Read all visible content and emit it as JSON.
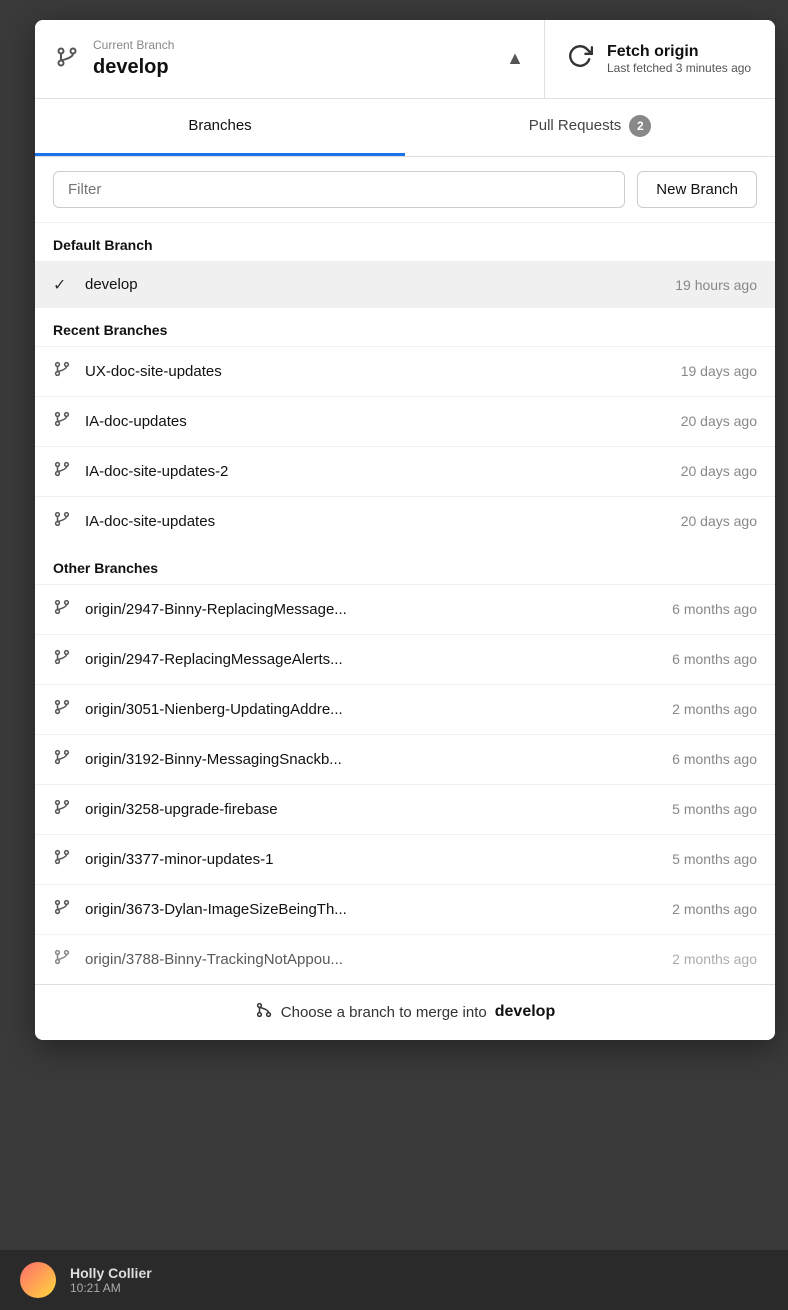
{
  "header": {
    "branch_label": "Current Branch",
    "branch_name": "develop",
    "fetch_title": "Fetch origin",
    "fetch_subtitle": "Last fetched 3 minutes ago"
  },
  "tabs": [
    {
      "id": "branches",
      "label": "Branches",
      "active": true,
      "badge": null
    },
    {
      "id": "pull-requests",
      "label": "Pull Requests",
      "active": false,
      "badge": "2"
    }
  ],
  "filter": {
    "placeholder": "Filter"
  },
  "new_branch_label": "New Branch",
  "sections": [
    {
      "title": "Default Branch",
      "items": [
        {
          "name": "develop",
          "time": "19 hours ago",
          "active": true,
          "check": true
        }
      ]
    },
    {
      "title": "Recent Branches",
      "items": [
        {
          "name": "UX-doc-site-updates",
          "time": "19 days ago",
          "active": false,
          "check": false
        },
        {
          "name": "IA-doc-updates",
          "time": "20 days ago",
          "active": false,
          "check": false
        },
        {
          "name": "IA-doc-site-updates-2",
          "time": "20 days ago",
          "active": false,
          "check": false
        },
        {
          "name": "IA-doc-site-updates",
          "time": "20 days ago",
          "active": false,
          "check": false
        }
      ]
    },
    {
      "title": "Other Branches",
      "items": [
        {
          "name": "origin/2947-Binny-ReplacingMessage...",
          "time": "6 months ago",
          "active": false,
          "check": false
        },
        {
          "name": "origin/2947-ReplacingMessageAlerts...",
          "time": "6 months ago",
          "active": false,
          "check": false
        },
        {
          "name": "origin/3051-Nienberg-UpdatingAddre...",
          "time": "2 months ago",
          "active": false,
          "check": false
        },
        {
          "name": "origin/3192-Binny-MessagingSnackb...",
          "time": "6 months ago",
          "active": false,
          "check": false
        },
        {
          "name": "origin/3258-upgrade-firebase",
          "time": "5 months ago",
          "active": false,
          "check": false
        },
        {
          "name": "origin/3377-minor-updates-1",
          "time": "5 months ago",
          "active": false,
          "check": false
        },
        {
          "name": "origin/3673-Dylan-ImageSizeBeingTh...",
          "time": "2 months ago",
          "active": false,
          "check": false
        },
        {
          "name": "origin/3788-Binny-TrackingNotAppou...",
          "time": "2 months ago",
          "active": false,
          "check": false,
          "partial": true
        }
      ]
    }
  ],
  "footer": {
    "text": "Choose a branch to merge into",
    "branch_name": "develop"
  },
  "bottom_bar": {
    "user_name": "Holly Collier",
    "user_time": "10:21 AM"
  }
}
